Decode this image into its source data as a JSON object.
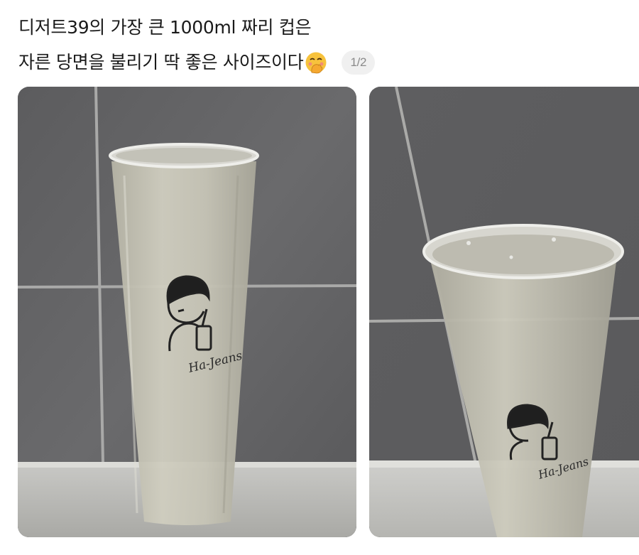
{
  "post": {
    "line1": "디저트39의 가장 큰 1000ml 짜리 컵은",
    "line2": "자른 당면을 불리기 딱 좋은 사이즈이다",
    "emoji": "face-with-hand-over-mouth-icon",
    "image_counter": "1/2"
  },
  "images": [
    {
      "cup_brand_text": "Ha-Jeans"
    },
    {
      "cup_brand_text": "Ha-Jeans"
    }
  ],
  "colors": {
    "counter_bg": "#f0f0f0",
    "counter_text": "#8a8a8a",
    "emoji": "#f7c23c"
  }
}
